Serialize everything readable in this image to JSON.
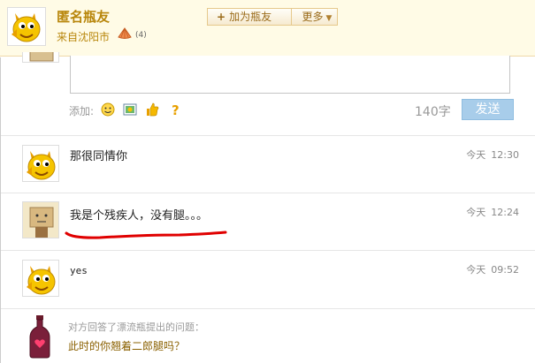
{
  "header": {
    "user_name": "匿名瓶友",
    "location": "来自沈阳市",
    "shell_count": "(4)",
    "add_friend_label": "加为瓶友",
    "more_label": "更多"
  },
  "compose": {
    "add_label": "添加:",
    "char_count": "140字",
    "send_label": "发送",
    "tools": [
      "emoji-icon",
      "image-icon",
      "thumbs-up-icon",
      "question-icon"
    ]
  },
  "messages": [
    {
      "text": "那很同情你",
      "day": "今天",
      "time": "12:30",
      "avatar": "fish-avatar"
    },
    {
      "text": "我是个残疾人，没有腿。。。",
      "day": "今天",
      "time": "12:24",
      "avatar": "box-avatar"
    },
    {
      "text": "yes",
      "day": "今天",
      "time": "09:52",
      "avatar": "fish-avatar"
    }
  ],
  "bottle": {
    "note": "对方回答了漂流瓶提出的问题：",
    "question": "此时的你翘着二郎腿吗？"
  },
  "colors": {
    "accent": "#b8860b",
    "send_button": "#a8cdea",
    "header_bg": "#fffbe6",
    "annotation": "#e00000"
  }
}
